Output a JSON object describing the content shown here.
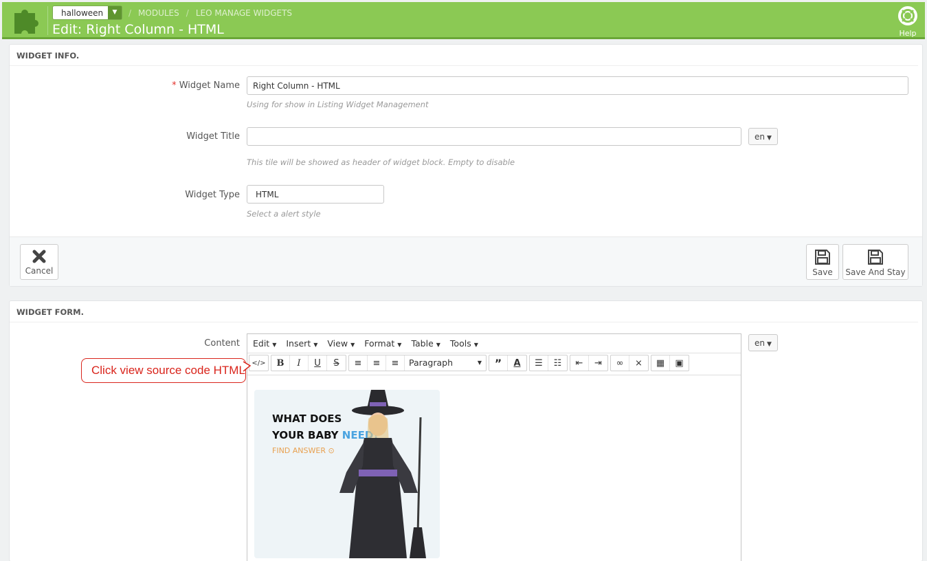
{
  "header": {
    "shop_select": "halloween",
    "breadcrumbs": [
      "MODULES",
      "LEO MANAGE WIDGETS"
    ],
    "title": "Edit: Right Column - HTML",
    "help_label": "Help",
    "brand_color": "#8bc954"
  },
  "widget_info": {
    "heading": "WIDGET INFO.",
    "name_label": "Widget Name",
    "name_value": "Right Column - HTML",
    "name_hint": "Using for show in Listing Widget Management",
    "title_label": "Widget Title",
    "title_value": "",
    "title_lang": "en",
    "title_hint": "This tile will be showed as header of widget block. Empty to disable",
    "type_label": "Widget Type",
    "type_value": "HTML",
    "type_hint": "Select a alert style",
    "cancel_label": "Cancel",
    "save_label": "Save",
    "save_stay_label": "Save And Stay"
  },
  "widget_form": {
    "heading": "WIDGET FORM.",
    "content_label": "Content",
    "content_lang": "en",
    "menus": [
      "Edit",
      "Insert",
      "View",
      "Format",
      "Table",
      "Tools"
    ],
    "format_select": "Paragraph",
    "toolbar_icons": [
      "source-code-icon",
      "bold-icon",
      "italic-icon",
      "underline-icon",
      "strikethrough-icon",
      "align-left-icon",
      "align-center-icon",
      "align-right-icon",
      "format-select",
      "blockquote-icon",
      "text-color-icon",
      "bullet-list-icon",
      "numbered-list-icon",
      "outdent-icon",
      "indent-icon",
      "link-icon",
      "unlink-icon",
      "media-icon",
      "image-icon"
    ],
    "banner": {
      "line1": "WHAT DOES",
      "line2_a": "YOUR BABY ",
      "line2_b": "NEED?",
      "cta": "FIND ANSWER"
    }
  },
  "annotation": {
    "callout_text": "Click view source code HTML",
    "callout_color": "#d9241b"
  }
}
